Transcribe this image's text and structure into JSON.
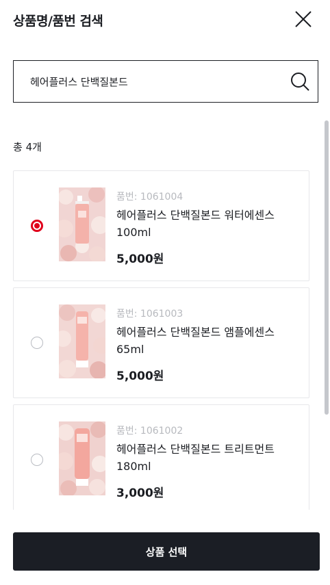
{
  "header": {
    "title": "상품명/품번 검색"
  },
  "search": {
    "value": "헤어플러스 단백질본드"
  },
  "result": {
    "count_label": "총 4개"
  },
  "products": [
    {
      "code": "품번: 1061004",
      "name": "헤어플러스 단백질본드 워터에센스 100ml",
      "price": "5,000원",
      "selected": true
    },
    {
      "code": "품번: 1061003",
      "name": "헤어플러스 단백질본드 앰플에센스 65ml",
      "price": "5,000원",
      "selected": false
    },
    {
      "code": "품번: 1061002",
      "name": "헤어플러스 단백질본드 트리트먼트 180ml",
      "price": "3,000원",
      "selected": false
    }
  ],
  "footer": {
    "select_label": "상품 선택"
  },
  "colors": {
    "accent_red": "#e0001b",
    "button_dark": "#1b1e25"
  },
  "icons": {
    "close": "close-icon",
    "search": "search-icon"
  }
}
